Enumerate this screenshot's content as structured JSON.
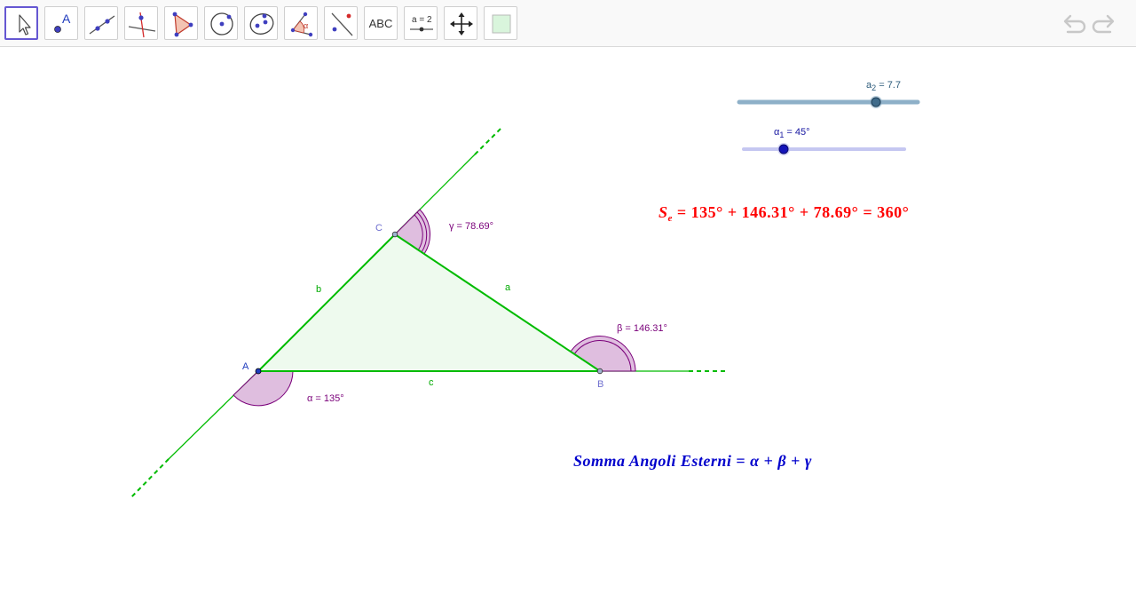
{
  "toolbar": {
    "tools": [
      {
        "name": "move-tool",
        "label": ""
      },
      {
        "name": "point-tool",
        "label": "A"
      },
      {
        "name": "line-tool",
        "label": ""
      },
      {
        "name": "perpendicular-tool",
        "label": ""
      },
      {
        "name": "polygon-tool",
        "label": ""
      },
      {
        "name": "circle-tool",
        "label": ""
      },
      {
        "name": "conic-tool",
        "label": ""
      },
      {
        "name": "angle-tool",
        "label": "α"
      },
      {
        "name": "reflect-tool",
        "label": ""
      },
      {
        "name": "text-tool",
        "label": "ABC"
      },
      {
        "name": "slider-tool",
        "label": "a = 2"
      },
      {
        "name": "move-graphics-tool",
        "label": ""
      },
      {
        "name": "image-tool",
        "label": ""
      }
    ],
    "selected_tool": "move-tool",
    "undo_icon": "undo-icon",
    "redo_icon": "redo-icon"
  },
  "sliders": {
    "a2": {
      "name": "a",
      "sub": "2",
      "eq": " = ",
      "value": "7.7"
    },
    "alpha1": {
      "name": "α",
      "sub": "1",
      "eq": " = ",
      "value": "45°"
    }
  },
  "points": {
    "A": "A",
    "B": "B",
    "C": "C"
  },
  "sides": {
    "a": "a",
    "b": "b",
    "c": "c"
  },
  "angles": {
    "alpha": "α = 135°",
    "beta": "β = 146.31°",
    "gamma": "γ = 78.69°"
  },
  "sum_formula": {
    "S": "S",
    "S_sub": "e",
    "eq": " = ",
    "t1": "135°",
    "plus1": " + ",
    "t2": "146.31°",
    "plus2": " + ",
    "t3": "78.69°",
    "eq2": " = ",
    "total": "360°"
  },
  "definition_formula": {
    "lhs": "Somma Angoli Esterni",
    "eq": " = ",
    "r1": "α",
    "plus1": " + ",
    "r2": "β",
    "plus2": " + ",
    "r3": "γ"
  },
  "colors": {
    "accent_tool": "#6557d2",
    "triangle": "#00bb00",
    "angle_fill": "#d9b3d9",
    "angle_stroke": "#7a007a",
    "label_angle": "#7a007a",
    "point_blue": "#1f3bbd",
    "sum_red": "#ff0000",
    "definition_blue": "#0000cc",
    "slider_a": "#8eb0c8",
    "slider_alpha": "#c5c7f1"
  }
}
